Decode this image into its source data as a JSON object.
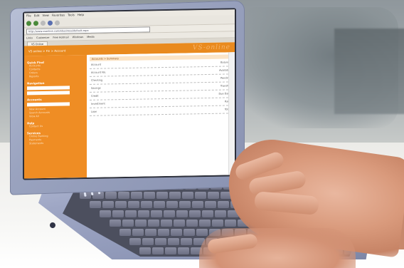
{
  "browser": {
    "menu": [
      "File",
      "Edit",
      "View",
      "Favorites",
      "Tools",
      "Help"
    ],
    "url": "http://www.vsonline.com/ebusiness/default.aspx",
    "links": [
      "Links",
      "Customize",
      "Free Hotmail",
      "Windows",
      "Media"
    ],
    "tab": "VS Online"
  },
  "page": {
    "logo": "VS-online",
    "crumb": "VS online > Fin > Account",
    "sidebar": {
      "sections": [
        {
          "title": "Quick Find",
          "items": [
            "Accounts",
            "Contacts",
            "Orders",
            "Reports"
          ]
        },
        {
          "title": "Navigation",
          "items": [
            "Overview",
            "Settings"
          ]
        },
        {
          "title": "Accounts",
          "items": [
            "New Account",
            "Search Accounts",
            "View All"
          ]
        },
        {
          "title": "Help",
          "items": [
            "Contact Us"
          ]
        },
        {
          "title": "Services",
          "items": [
            "Online Banking",
            "Payments",
            "Statements"
          ]
        }
      ]
    },
    "main": {
      "top": "Accounts > Summary",
      "rows": [
        {
          "l": "Account",
          "r": "Balance"
        },
        {
          "l": "Account No.",
          "r": "Available"
        },
        {
          "l": "Checking",
          "r": "Pending"
        },
        {
          "l": "Savings",
          "r": "Transfer"
        },
        {
          "l": "Credit",
          "r": "Due Date"
        },
        {
          "l": "Investment",
          "r": "Rate"
        },
        {
          "l": "Loan",
          "r": "Total"
        }
      ]
    }
  }
}
